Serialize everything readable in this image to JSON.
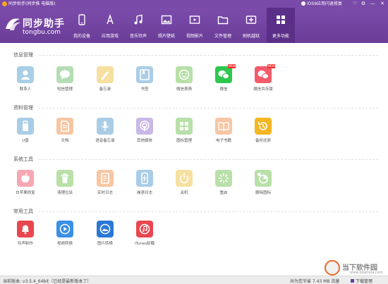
{
  "titlebar": {
    "title": "同步助手(同步推 电脑版)",
    "ios_link": "iOS9应用闪退修复",
    "controls": [
      "♡",
      "⚙",
      "—",
      "✕"
    ]
  },
  "logo": {
    "name": "同步助手",
    "domain": "tongbu.com"
  },
  "nav": [
    {
      "label": "我的设备",
      "icon": "device-icon"
    },
    {
      "label": "应用游戏",
      "icon": "app-store-icon"
    },
    {
      "label": "音乐铃声",
      "icon": "music-icon"
    },
    {
      "label": "照片壁纸",
      "icon": "photo-icon"
    },
    {
      "label": "视频影片",
      "icon": "video-icon"
    },
    {
      "label": "文件管理",
      "icon": "folder-icon"
    },
    {
      "label": "刷机越狱",
      "icon": "flash-icon"
    },
    {
      "label": "更多功能",
      "icon": "grid-icon",
      "active": true
    }
  ],
  "sections": [
    {
      "title": "信息管理",
      "items": [
        {
          "label": "联系人",
          "icon": "contact-icon",
          "color": "#a8cfe8"
        },
        {
          "label": "短信管理",
          "icon": "message-icon",
          "color": "#b5ddb5"
        },
        {
          "label": "备忘录",
          "icon": "memo-icon",
          "color": "#f6e0a0"
        },
        {
          "label": "书签",
          "icon": "bookmark-icon",
          "color": "#a9cde6"
        },
        {
          "label": "微信表情",
          "icon": "emoji-icon",
          "color": "#b8e0a8"
        },
        {
          "label": "微信",
          "icon": "wechat-icon",
          "color": "#2dc84d",
          "badge": "NEW"
        },
        {
          "label": "微信共存版",
          "icon": "wechat-dual-icon",
          "color": "#f25c6a",
          "badge": "NEW"
        }
      ]
    },
    {
      "title": "资料管理",
      "items": [
        {
          "label": "U盘",
          "icon": "usb-icon",
          "color": "#a9cde6"
        },
        {
          "label": "文档",
          "icon": "document-icon",
          "color": "#f7c6a3"
        },
        {
          "label": "语音备忘录",
          "icon": "microphone-icon",
          "color": "#a9cde6"
        },
        {
          "label": "其他媒体",
          "icon": "podcast-icon",
          "color": "#c9b8e6"
        },
        {
          "label": "图标管理",
          "icon": "icon-grid-icon",
          "color": "#b8e0a8"
        },
        {
          "label": "电子书籍",
          "icon": "ebook-icon",
          "color": "#f7c6a3"
        },
        {
          "label": "备份还原",
          "icon": "backup-icon",
          "color": "#f5b623"
        }
      ]
    },
    {
      "title": "系统工具",
      "items": [
        {
          "label": "白苹果修复",
          "icon": "apple-repair-icon",
          "color": "#f5a8b3"
        },
        {
          "label": "清理垃圾",
          "icon": "trash-icon",
          "color": "#b8e0a8"
        },
        {
          "label": "实时日志",
          "icon": "log-icon",
          "color": "#f7c6a3"
        },
        {
          "label": "崩溃日志",
          "icon": "crash-log-icon",
          "color": "#a9cde6"
        },
        {
          "label": "关机",
          "icon": "power-icon",
          "color": "#f6e0a0"
        },
        {
          "label": "重启",
          "icon": "restart-icon",
          "color": "#b8e0a8"
        },
        {
          "label": "删除图标",
          "icon": "delete-icon-icon",
          "color": "#b8e0a8"
        }
      ]
    },
    {
      "title": "常用工具",
      "items": [
        {
          "label": "铃声制作",
          "icon": "bell-icon",
          "color": "#e8474f"
        },
        {
          "label": "视频转换",
          "icon": "video-convert-icon",
          "color": "#3b8fe6"
        },
        {
          "label": "图片转换",
          "icon": "image-convert-icon",
          "color": "#2a78d6"
        },
        {
          "label": "iTunes卸载",
          "icon": "itunes-icon",
          "color": "#e8474f"
        }
      ]
    }
  ],
  "status": {
    "version": "当前版本: v3.5.4_64bit（已经是最新版本了）",
    "saved": "共为您节省 7.43 MB 流量",
    "download": "下载管理"
  },
  "watermark": {
    "text": "当下软件园",
    "url": "www.downxia.com"
  }
}
